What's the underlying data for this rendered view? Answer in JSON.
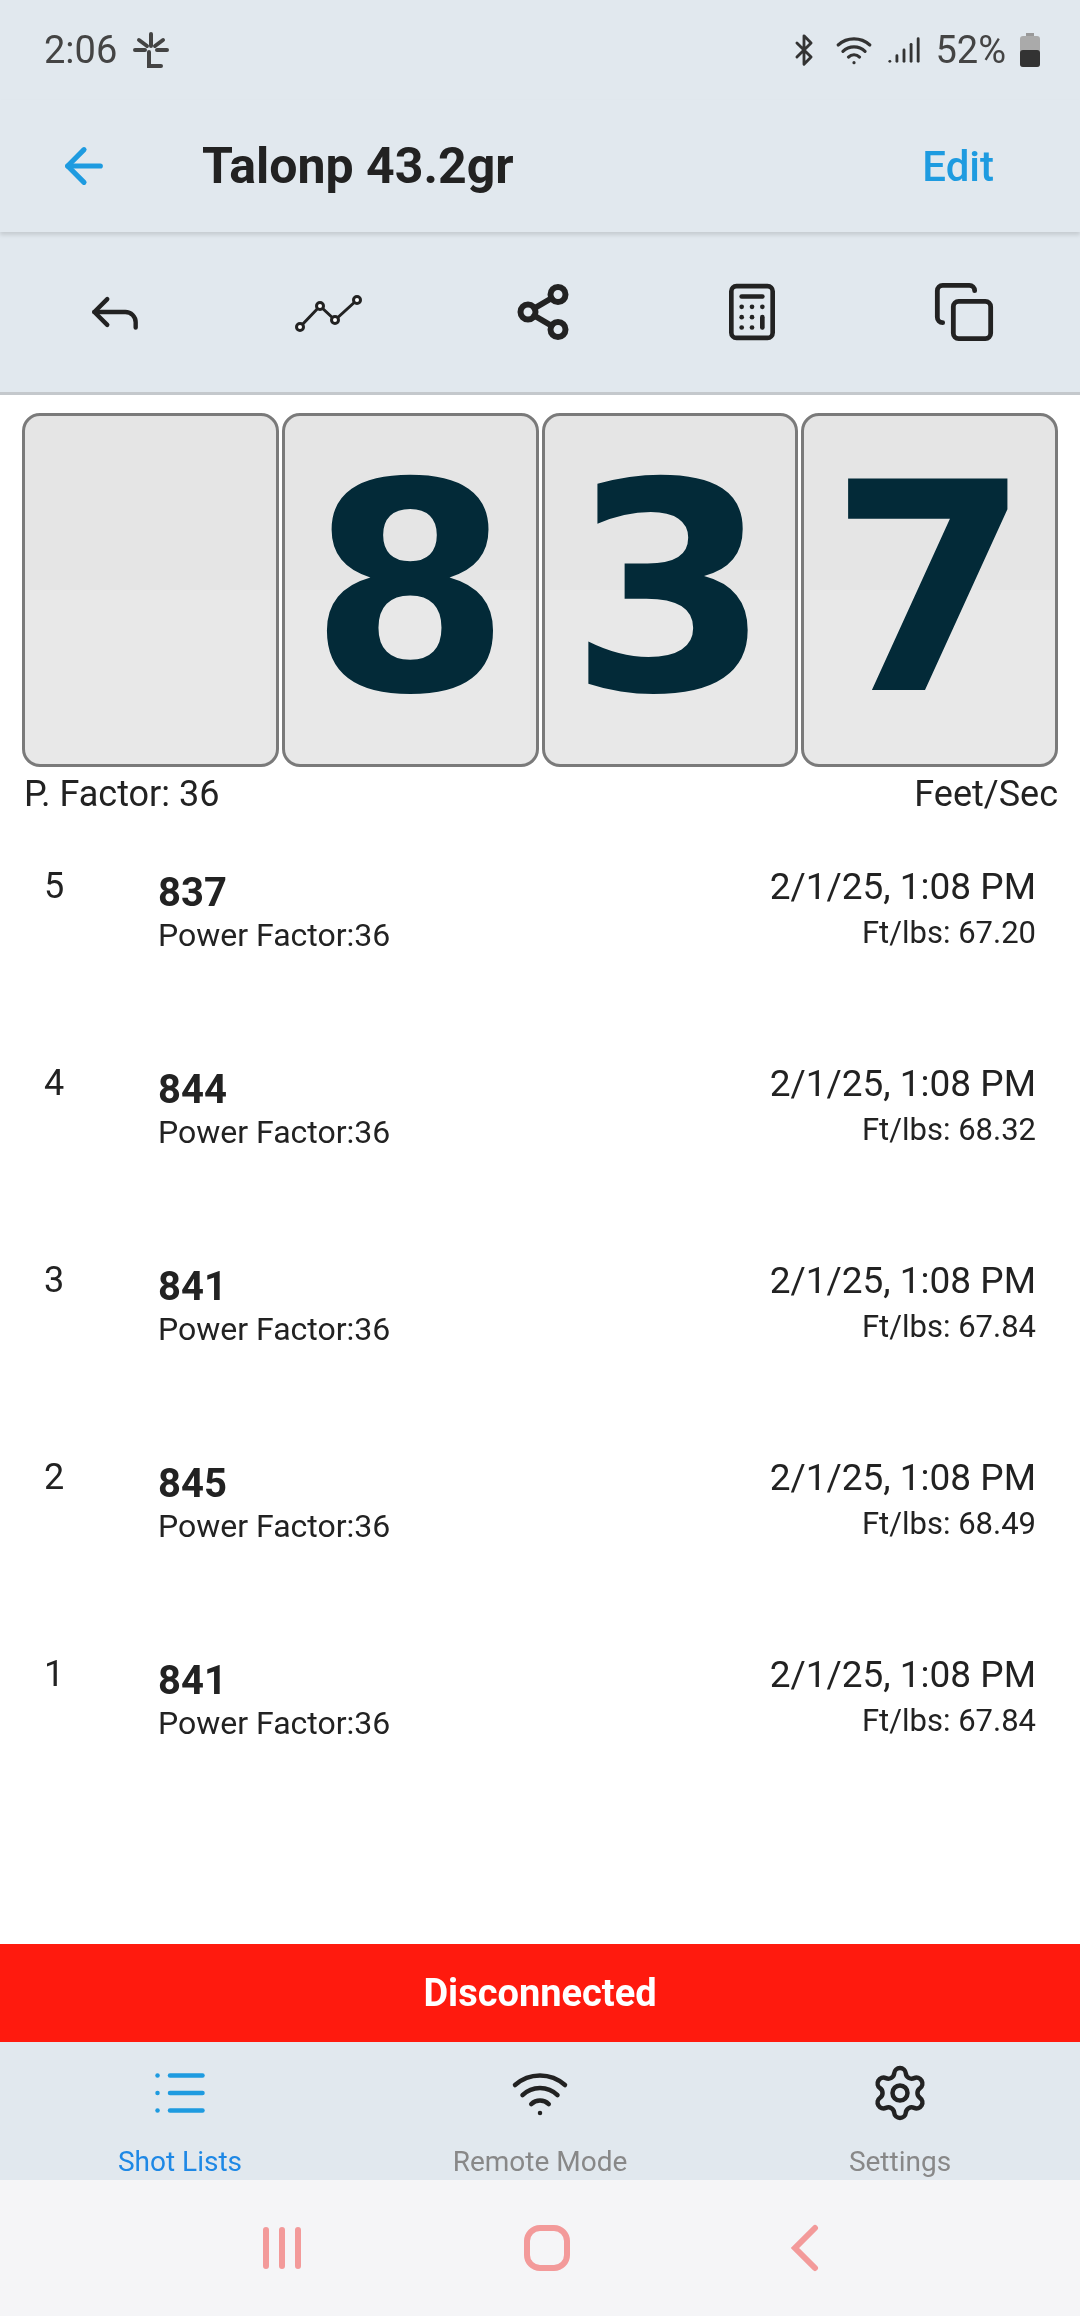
{
  "status_bar": {
    "time": "2:06",
    "battery": "52%"
  },
  "header": {
    "title": "Talonp 43.2gr",
    "action": "Edit"
  },
  "display": {
    "reading": "837",
    "power_factor": "P. Factor: 36",
    "unit": "Feet/Sec"
  },
  "shots": [
    {
      "index": "5",
      "velocity": "837",
      "power_factor": "Power Factor:36",
      "time": "2/1/25, 1:08 PM",
      "energy": "Ft/lbs: 67.20"
    },
    {
      "index": "4",
      "velocity": "844",
      "power_factor": "Power Factor:36",
      "time": "2/1/25, 1:08 PM",
      "energy": "Ft/lbs: 68.32"
    },
    {
      "index": "3",
      "velocity": "841",
      "power_factor": "Power Factor:36",
      "time": "2/1/25, 1:08 PM",
      "energy": "Ft/lbs: 67.84"
    },
    {
      "index": "2",
      "velocity": "845",
      "power_factor": "Power Factor:36",
      "time": "2/1/25, 1:08 PM",
      "energy": "Ft/lbs: 68.49"
    },
    {
      "index": "1",
      "velocity": "841",
      "power_factor": "Power Factor:36",
      "time": "2/1/25, 1:08 PM",
      "energy": "Ft/lbs: 67.84"
    }
  ],
  "connection_banner": "Disconnected",
  "tabs": [
    {
      "label": "Shot Lists",
      "selected": true
    },
    {
      "label": "Remote Mode",
      "selected": false
    },
    {
      "label": "Settings",
      "selected": false
    }
  ]
}
